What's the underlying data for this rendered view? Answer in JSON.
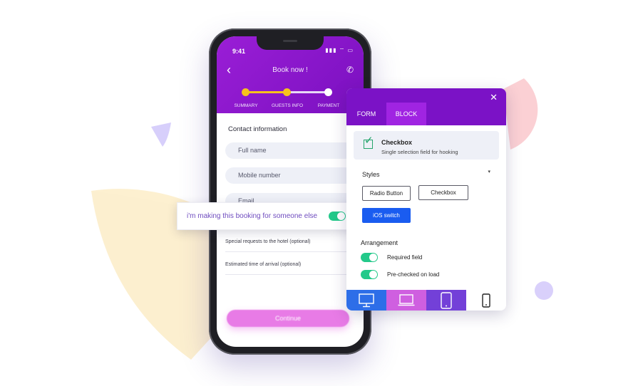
{
  "phone": {
    "status_time": "9:41",
    "status_icons": "▮▮▮ ⌔ ▭",
    "back_icon": "‹",
    "title": "Book now !",
    "call_icon": "✆",
    "steps": [
      "SUMMARY",
      "GUESTS INFO",
      "PAYMENT"
    ],
    "contact_title": "Contact information",
    "fields": [
      {
        "placeholder": "Full name"
      },
      {
        "placeholder": "Mobile number"
      },
      {
        "placeholder": "Email"
      }
    ],
    "requests_label": "Special requests to the hotel (optional)",
    "arrival_label": "Estimated time of arrival (optional)",
    "continue_label": "Continue"
  },
  "someone_card": {
    "label": "i'm making this booking for someone else",
    "toggle_on": true
  },
  "panel": {
    "close_icon": "✕",
    "tabs": [
      "FORM",
      "BLOCK"
    ],
    "active_tab": "BLOCK",
    "block": {
      "title": "Checkbox",
      "description": "Single selection field for hooking"
    },
    "styles_label": "Styles",
    "caret_icon": "▾",
    "style_options": [
      "Radio Button",
      "Checkbox",
      "iOS switch"
    ],
    "selected_style": "iOS switch",
    "arrangement_label": "Arrangement",
    "arrangement_options": [
      {
        "label": "Required field",
        "on": true
      },
      {
        "label": "Pre-checked on load",
        "on": true
      }
    ],
    "devices": [
      "desktop-icon",
      "laptop-icon",
      "tablet-icon",
      "mobile-icon"
    ]
  },
  "colors": {
    "brand_purple": "#7b12c6",
    "accent_yellow": "#f6c21c",
    "toggle_green": "#23c98a",
    "primary_blue": "#1a5cf0",
    "device_blue": "#2d6ee8",
    "device_pink": "#cf5fe0",
    "device_violet": "#7340d8"
  }
}
